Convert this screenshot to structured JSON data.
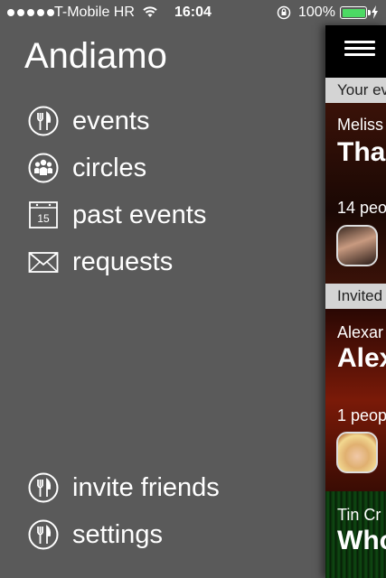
{
  "status_bar": {
    "carrier": "T-Mobile HR",
    "time": "16:04",
    "battery": "100%",
    "battery_level": 1.0
  },
  "menu": {
    "app_title": "Andiamo",
    "items": [
      {
        "label": "events",
        "icon": "fork-knife-icon"
      },
      {
        "label": "circles",
        "icon": "people-icon"
      },
      {
        "label": "past events",
        "icon": "calendar-icon",
        "icon_text": "15"
      },
      {
        "label": "requests",
        "icon": "envelope-icon"
      }
    ],
    "bottom_items": [
      {
        "label": "invite friends",
        "icon": "fork-knife-icon"
      },
      {
        "label": "settings",
        "icon": "fork-knife-icon"
      }
    ]
  },
  "panel": {
    "section1": "Your ev",
    "card1": {
      "owner": "Meliss",
      "title": "Tha",
      "people": "14 peo"
    },
    "section2": "Invited",
    "card2": {
      "owner": "Alexar",
      "title": "Alex",
      "people": "1 peop"
    },
    "card3": {
      "owner": "Tin Cr",
      "title": "Who"
    },
    "colors": {
      "card1_bg": "#3a1208",
      "card2_bg": "#7a1a08",
      "card3_bg": "#0a2a0a"
    }
  }
}
